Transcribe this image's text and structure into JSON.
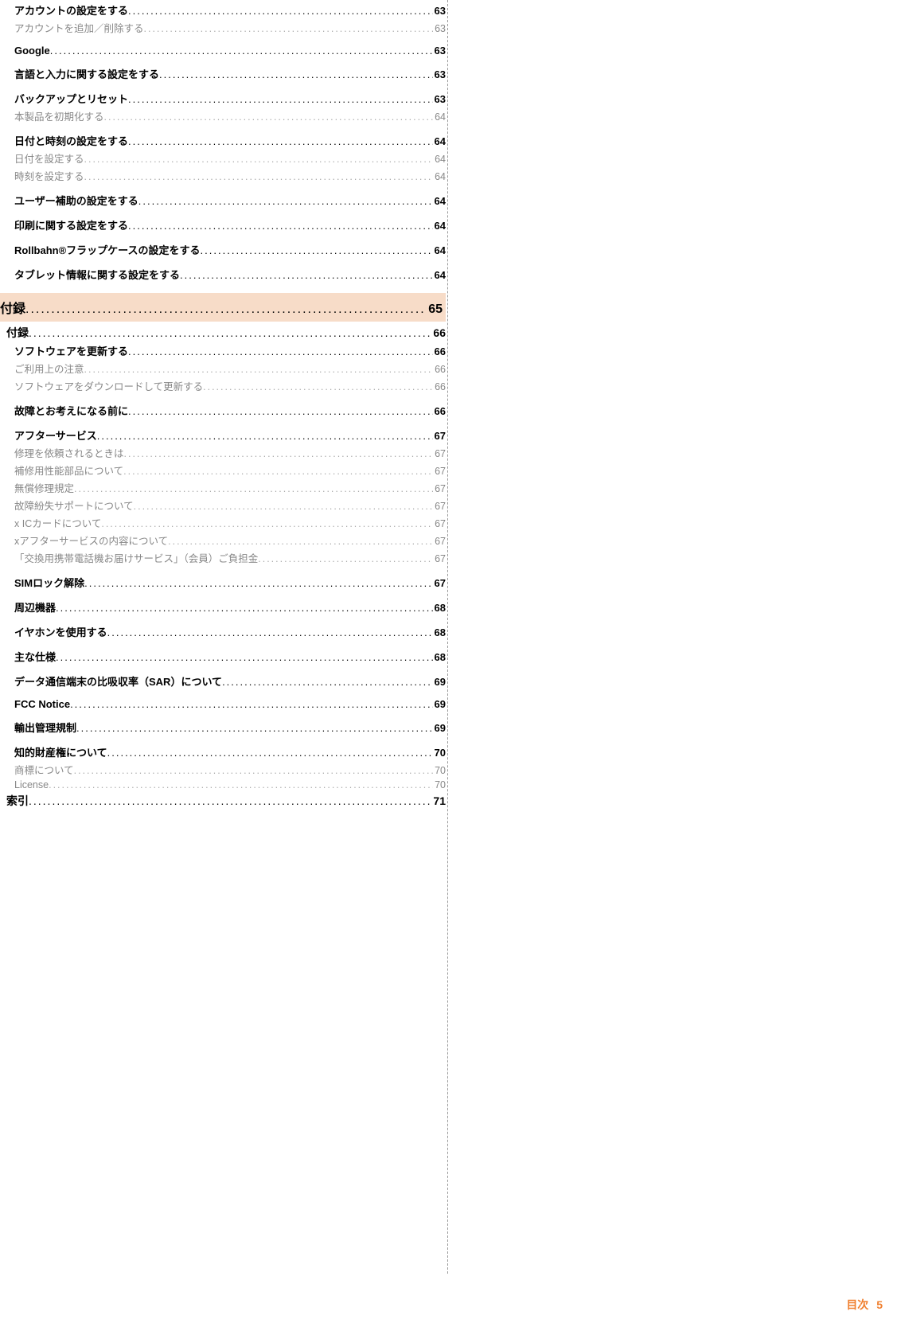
{
  "footer": {
    "label": "目次",
    "page": "5"
  },
  "dots": "..........................................................................................................................................................................................................",
  "toc": [
    {
      "level": 2,
      "label": "アカウントの設定をする",
      "page": "63"
    },
    {
      "level": 3,
      "label": "アカウントを追加／削除する",
      "page": "63"
    },
    {
      "sep": true
    },
    {
      "level": 2,
      "label": "Google",
      "page": "63"
    },
    {
      "sep": true
    },
    {
      "level": 2,
      "label": "言語と入力に関する設定をする",
      "page": "63"
    },
    {
      "sep": true
    },
    {
      "level": 2,
      "label": "バックアップとリセット",
      "page": "63"
    },
    {
      "level": 3,
      "label": "本製品を初期化する",
      "page": "64"
    },
    {
      "sep": true
    },
    {
      "level": 2,
      "label": "日付と時刻の設定をする",
      "page": "64"
    },
    {
      "level": 3,
      "label": "日付を設定する",
      "page": "64"
    },
    {
      "level": 3,
      "label": "時刻を設定する",
      "page": "64"
    },
    {
      "sep": true
    },
    {
      "level": 2,
      "label": "ユーザー補助の設定をする",
      "page": "64"
    },
    {
      "sep": true
    },
    {
      "level": 2,
      "label": "印刷に関する設定をする",
      "page": "64"
    },
    {
      "sep": true
    },
    {
      "level": 2,
      "label": "Rollbahn®フラップケースの設定をする",
      "page": "64"
    },
    {
      "sep": true
    },
    {
      "level": 2,
      "label": "タブレット情報に関する設定をする",
      "page": "64"
    },
    {
      "chapter": true,
      "level": 0,
      "label": "付録",
      "page": "65"
    },
    {
      "level": 1,
      "label": "付録",
      "page": "66"
    },
    {
      "level": 2,
      "label": "ソフトウェアを更新する",
      "page": "66"
    },
    {
      "level": 3,
      "label": "ご利用上の注意",
      "page": "66"
    },
    {
      "level": 3,
      "label": "ソフトウェアをダウンロードして更新する",
      "page": "66"
    },
    {
      "sep": true
    },
    {
      "level": 2,
      "label": "故障とお考えになる前に",
      "page": "66"
    },
    {
      "sep": true
    },
    {
      "level": 2,
      "label": "アフターサービス",
      "page": "67"
    },
    {
      "level": 3,
      "label": "修理を依頼されるときは",
      "page": "67"
    },
    {
      "level": 3,
      "label": "補修用性能部品について",
      "page": "67"
    },
    {
      "level": 3,
      "label": "無償修理規定",
      "page": "67"
    },
    {
      "level": 3,
      "label": "故障紛失サポートについて",
      "page": "67"
    },
    {
      "level": 3,
      "label": "x ICカードについて",
      "page": "67"
    },
    {
      "level": 3,
      "label": "xアフターサービスの内容について",
      "page": "67"
    },
    {
      "level": 3,
      "label": "「交換用携帯電話機お届けサービス」（会員）ご負担金",
      "page": "67"
    },
    {
      "sep": true
    },
    {
      "level": 2,
      "label": "SIMロック解除",
      "page": "67"
    },
    {
      "sep": true
    },
    {
      "level": 2,
      "label": "周辺機器",
      "page": "68"
    },
    {
      "sep": true
    },
    {
      "level": 2,
      "label": "イヤホンを使用する",
      "page": "68"
    },
    {
      "sep": true
    },
    {
      "level": 2,
      "label": "主な仕様",
      "page": "68"
    },
    {
      "sep": true
    },
    {
      "level": 2,
      "label": "データ通信端末の比吸収率（SAR）について",
      "page": "69"
    },
    {
      "sep": true
    },
    {
      "level": 2,
      "label": "FCC Notice",
      "page": "69"
    },
    {
      "sep": true
    },
    {
      "level": 2,
      "label": "輸出管理規制",
      "page": "69"
    },
    {
      "sep": true
    },
    {
      "level": 2,
      "label": "知的財産権について",
      "page": "70"
    },
    {
      "level": 3,
      "label": "商標について",
      "page": "70"
    },
    {
      "level": 3,
      "label": "License",
      "page": "70"
    },
    {
      "level": 1,
      "label": "索引",
      "page": "71"
    }
  ]
}
